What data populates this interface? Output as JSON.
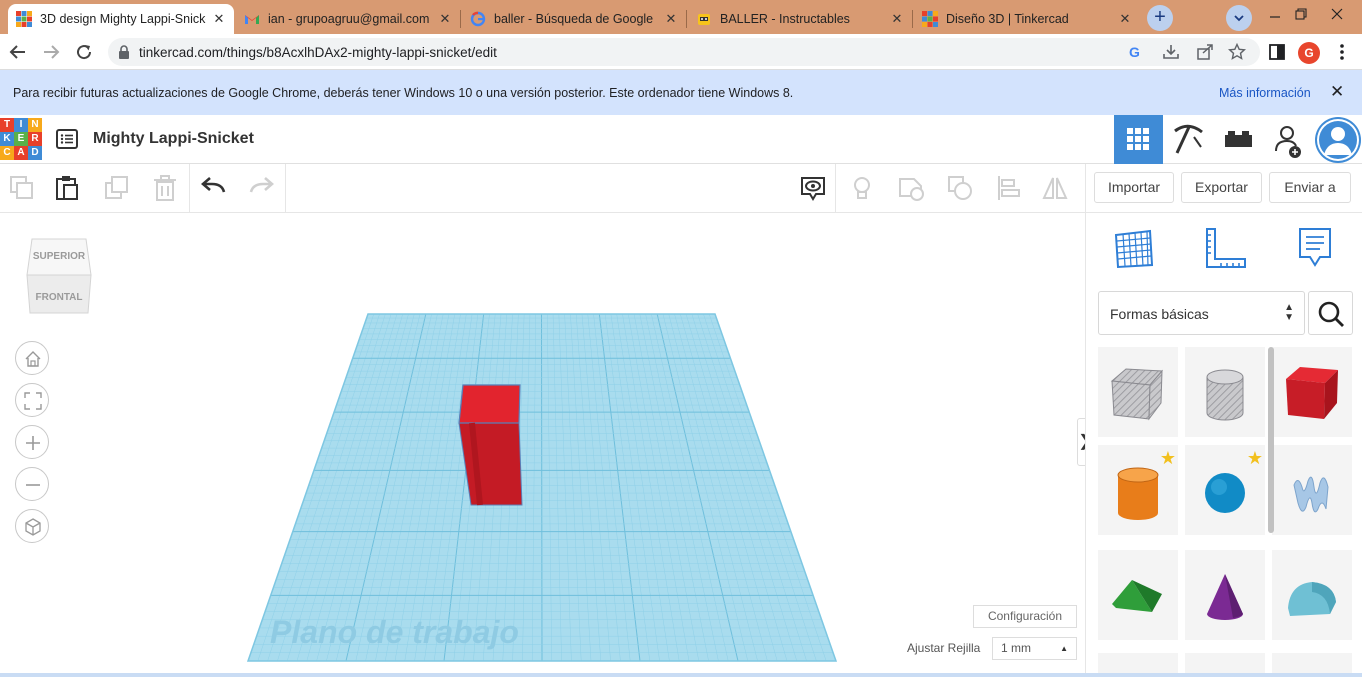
{
  "browser": {
    "tabs": [
      {
        "title": "3D design Mighty Lappi-Snicke",
        "close": "✕",
        "active": true
      },
      {
        "title": "ian - grupoagruu@gmail.com",
        "close": "✕",
        "active": false
      },
      {
        "title": "baller - Búsqueda de Google",
        "close": "✕",
        "active": false
      },
      {
        "title": "BALLER - Instructables",
        "close": "✕",
        "active": false
      },
      {
        "title": "Diseño 3D | Tinkercad",
        "close": "✕",
        "active": false
      }
    ],
    "new_tab": "+",
    "url": "tinkercad.com/things/b8AcxlhDAx2-mighty-lappi-snicket/edit",
    "profile_initial": "G"
  },
  "infobar": {
    "message": "Para recibir futuras actualizaciones de Google Chrome, deberás tener Windows 10 o una versión posterior. Este ordenador tiene Windows 8.",
    "link": "Más información",
    "close": "✕"
  },
  "header": {
    "logo_letters": [
      "T",
      "I",
      "N",
      "K",
      "E",
      "R",
      "C",
      "A",
      "D"
    ],
    "design_title": "Mighty Lappi-Snicket"
  },
  "toolbar": {
    "import_label": "Importar",
    "export_label": "Exportar",
    "send_label": "Enviar a"
  },
  "viewport": {
    "viewcube_top": "SUPERIOR",
    "viewcube_front": "FRONTAL",
    "workplane_label": "Plano de trabajo",
    "settings_label": "Configuración",
    "snap_label": "Ajustar Rejilla",
    "snap_value": "1 mm",
    "collapse_glyph": "❯"
  },
  "panel": {
    "category": "Formas básicas",
    "shapes": [
      {
        "name": "box-hole",
        "starred": false
      },
      {
        "name": "cylinder-hole",
        "starred": false
      },
      {
        "name": "box",
        "starred": false
      },
      {
        "name": "cylinder",
        "starred": true
      },
      {
        "name": "sphere",
        "starred": true
      },
      {
        "name": "scribble",
        "starred": false
      },
      {
        "name": "roof",
        "starred": false
      },
      {
        "name": "cone",
        "starred": false
      },
      {
        "name": "round-roof",
        "starred": false
      }
    ]
  },
  "colors": {
    "chrome_frame": "#d89a72",
    "tinkercad_blue": "#3f8bd6",
    "workplane": "#a9dcee",
    "box_red": "#d8202a"
  }
}
